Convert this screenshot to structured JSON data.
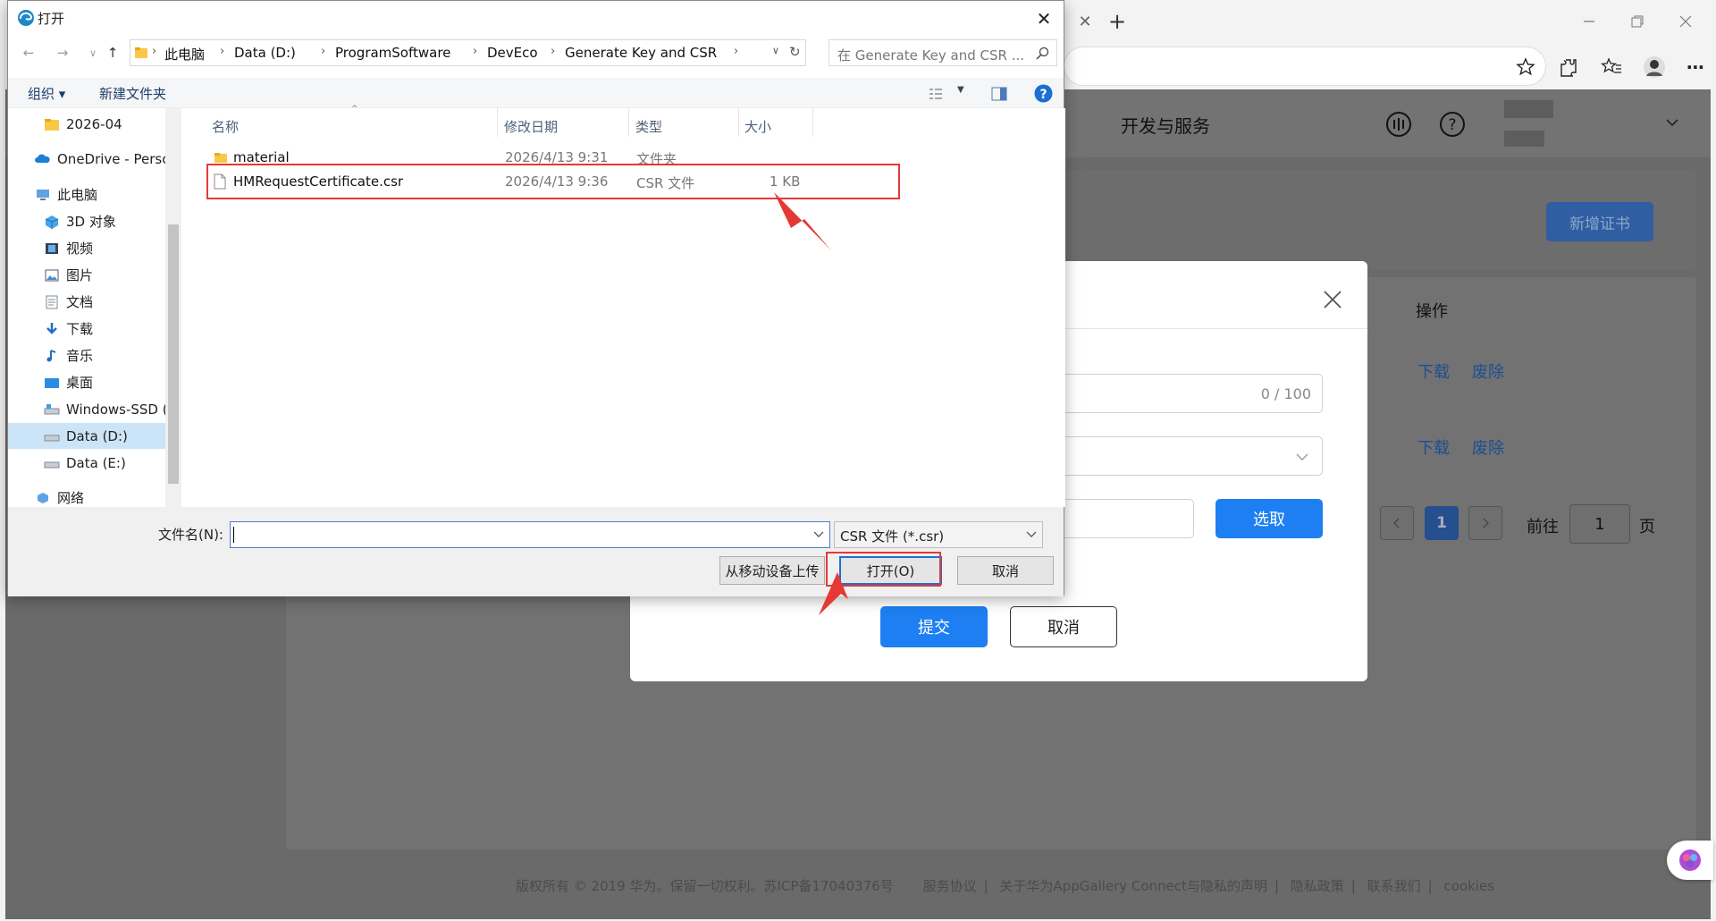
{
  "dialog": {
    "title": "打开",
    "breadcrumb": [
      "此电脑",
      "Data (D:)",
      "ProgramSoftware",
      "DevEco",
      "Generate Key and CSR"
    ],
    "search_placeholder": "在 Generate Key and CSR ...",
    "toolbar": {
      "organize": "组织 ▾",
      "new_folder": "新建文件夹"
    },
    "nav_items": [
      {
        "label": "2026-04",
        "icon": "folder-icon"
      },
      {
        "label": "OneDrive - Persc",
        "icon": "onedrive-icon"
      },
      {
        "label": "此电脑",
        "icon": "computer-icon"
      },
      {
        "label": "3D 对象",
        "icon": "3d-objects-icon"
      },
      {
        "label": "视频",
        "icon": "video-icon"
      },
      {
        "label": "图片",
        "icon": "pictures-icon"
      },
      {
        "label": "文档",
        "icon": "documents-icon"
      },
      {
        "label": "下载",
        "icon": "download-icon"
      },
      {
        "label": "音乐",
        "icon": "music-icon"
      },
      {
        "label": "桌面",
        "icon": "desktop-icon"
      },
      {
        "label": "Windows-SSD (",
        "icon": "drive-icon"
      },
      {
        "label": "Data (D:)",
        "icon": "drive-icon"
      },
      {
        "label": "Data (E:)",
        "icon": "drive-icon"
      },
      {
        "label": "网络",
        "icon": "network-icon"
      }
    ],
    "columns": {
      "name": "名称",
      "date": "修改日期",
      "type": "类型",
      "size": "大小"
    },
    "files": [
      {
        "name": "material",
        "date": "2026/4/13 9:31",
        "type": "文件夹",
        "size": "",
        "icon": "folder-icon"
      },
      {
        "name": "HMRequestCertificate.csr",
        "date": "2026/4/13 9:36",
        "type": "CSR 文件",
        "size": "1 KB",
        "icon": "file-icon"
      }
    ],
    "filename_label": "文件名(N):",
    "filename_value": "",
    "filetype": "CSR 文件 (*.csr)",
    "buttons": {
      "mobile_upload": "从移动设备上传",
      "open": "打开(O)",
      "cancel": "取消"
    }
  },
  "browser": {
    "site_nav": "开发与服务",
    "new_cert_button": "新增证书",
    "ops_header": "操作",
    "row_links": [
      {
        "download": "下载",
        "revoke": "废除"
      },
      {
        "download": "下载",
        "revoke": "废除"
      }
    ],
    "pagination": {
      "current": "1",
      "goto_label": "前往",
      "goto_value": "1",
      "page_suffix": "页"
    },
    "footer": {
      "copyright": "版权所有 © 2019 华为。保留一切权利。苏ICP备17040376号",
      "links": [
        "服务协议",
        "关于华为AppGallery Connect与隐私的声明",
        "隐私政策",
        "联系我们",
        "cookies"
      ]
    }
  },
  "modal": {
    "counter": "0 / 100",
    "select_button": "选取",
    "submit_button": "提交",
    "cancel_button": "取消"
  },
  "colors": {
    "accent": "#1e7ff2",
    "highlight": "#e53935"
  }
}
